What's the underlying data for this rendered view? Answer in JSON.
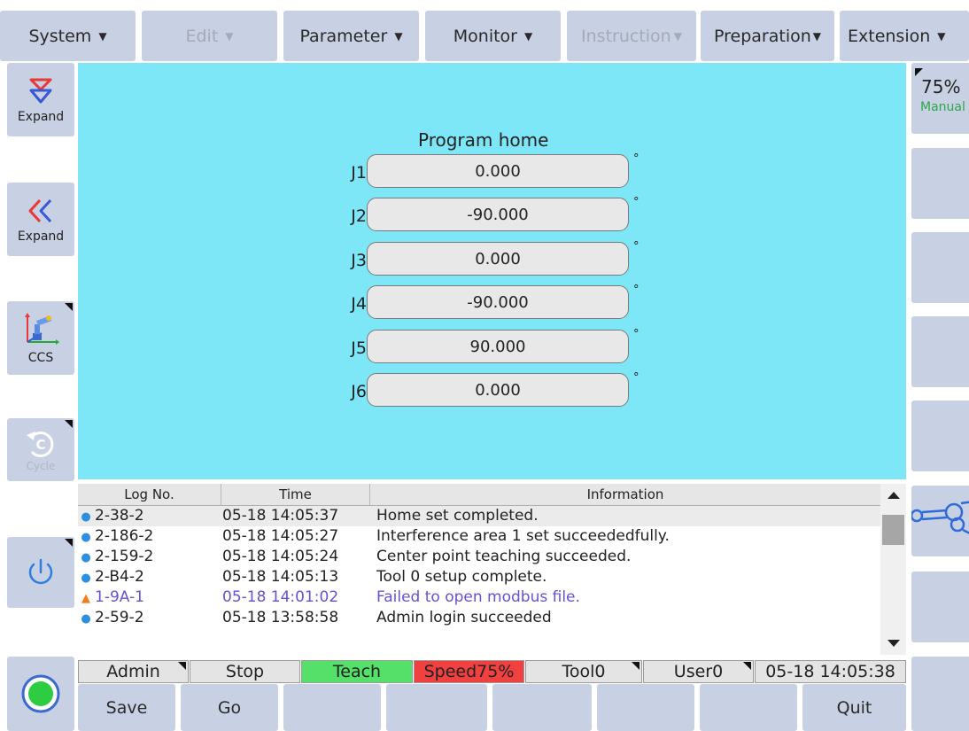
{
  "menus": [
    {
      "label": "System",
      "disabled": false
    },
    {
      "label": "Edit",
      "disabled": true
    },
    {
      "label": "Parameter",
      "disabled": false
    },
    {
      "label": "Monitor",
      "disabled": false
    },
    {
      "label": "Instruction",
      "disabled": true
    },
    {
      "label": "Preparation",
      "disabled": false
    },
    {
      "label": "Extension",
      "disabled": false
    }
  ],
  "left_toolbar": {
    "expand_down_label": "Expand",
    "expand_left_label": "Expand",
    "coord_label": "CCS",
    "cycle_label": "Cycle"
  },
  "right_toolbar": {
    "speed": "75%",
    "mode": "Manual"
  },
  "program_home": {
    "title": "Program home",
    "unit": "°",
    "joints": [
      {
        "label": "J1",
        "value": "0.000"
      },
      {
        "label": "J2",
        "value": "-90.000"
      },
      {
        "label": "J3",
        "value": "0.000"
      },
      {
        "label": "J4",
        "value": "-90.000"
      },
      {
        "label": "J5",
        "value": "90.000"
      },
      {
        "label": "J6",
        "value": "0.000"
      }
    ]
  },
  "log": {
    "headers": {
      "no": "Log No.",
      "time": "Time",
      "info": "Information"
    },
    "rows": [
      {
        "level": "info",
        "no": "2-38-2",
        "time": "05-18 14:05:37",
        "info": "Home set completed."
      },
      {
        "level": "info",
        "no": "2-186-2",
        "time": "05-18 14:05:27",
        "info": "Interference area 1 set succeededfully."
      },
      {
        "level": "info",
        "no": "2-159-2",
        "time": "05-18 14:05:24",
        "info": "Center point teaching succeeded."
      },
      {
        "level": "info",
        "no": "2-B4-2",
        "time": "05-18 14:05:13",
        "info": "Tool 0 setup complete."
      },
      {
        "level": "warn",
        "no": "1-9A-1",
        "time": "05-18 14:01:02",
        "info": "Failed to open modbus file."
      },
      {
        "level": "info",
        "no": "2-59-2",
        "time": "05-18 13:58:58",
        "info": "Admin  login succeeded"
      }
    ]
  },
  "status": {
    "user": "Admin",
    "run_state": "Stop",
    "mode": "Teach",
    "speed": "Speed75%",
    "tool": "Tool0",
    "user_frame": "User0",
    "datetime": "05-18 14:05:38"
  },
  "bottom": {
    "save": "Save",
    "go": "Go",
    "quit": "Quit"
  },
  "colors": {
    "panel_bg": "#7de7f7",
    "button_bg": "#c8d0e4",
    "teach_green": "#55e06a",
    "speed_red": "#f04040"
  }
}
